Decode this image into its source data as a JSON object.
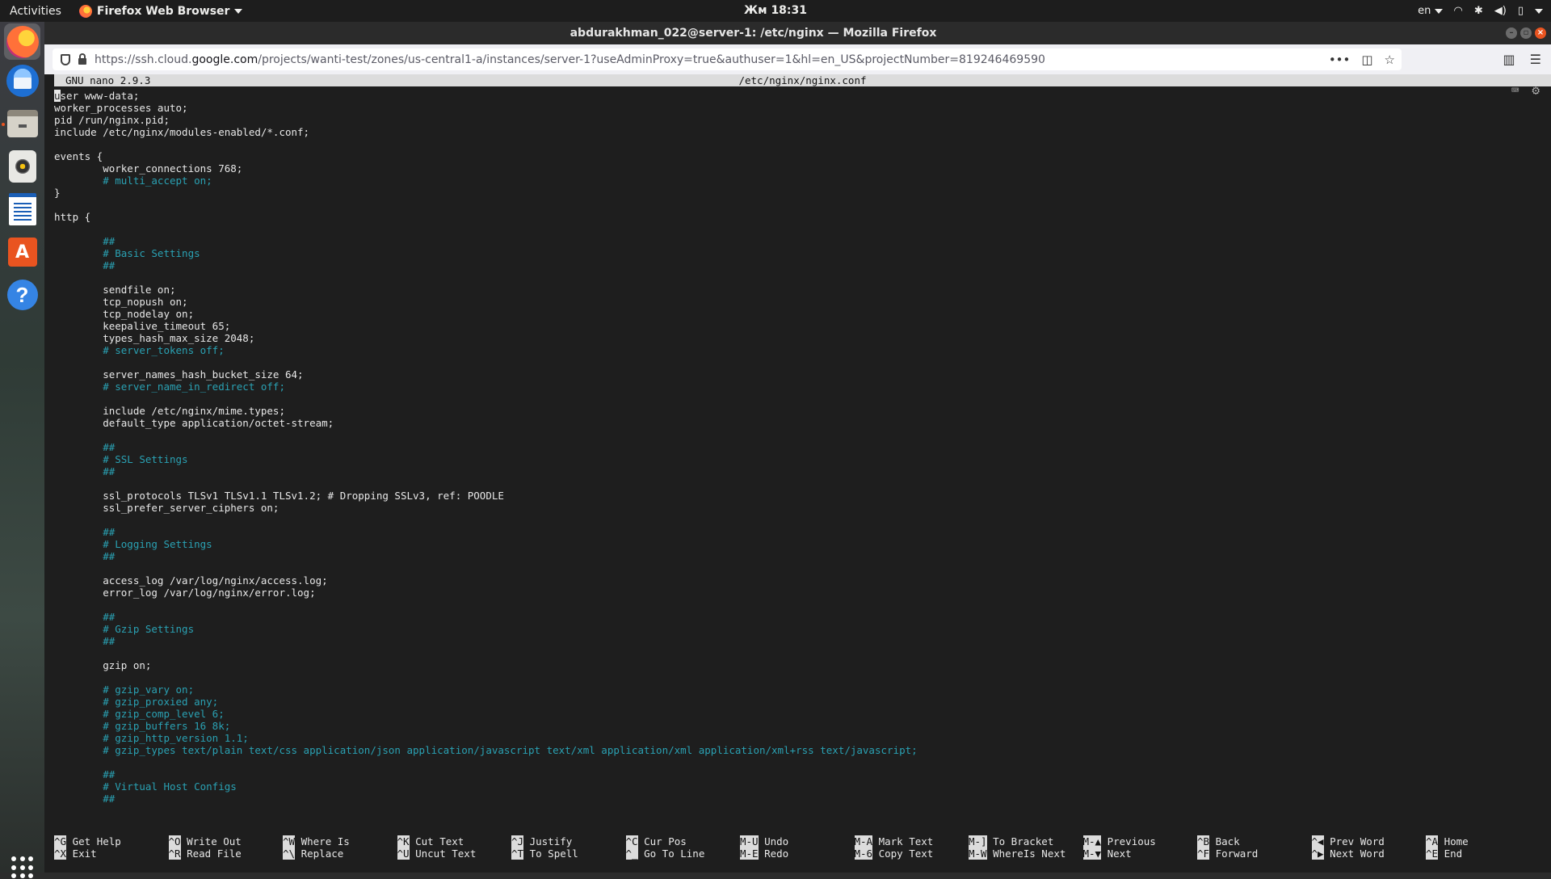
{
  "topbar": {
    "activities": "Activities",
    "app_name": "Firefox Web Browser",
    "clock": "Жм 18:31",
    "lang": "en"
  },
  "window": {
    "title": "abdurakhman_022@server-1: /etc/nginx — Mozilla Firefox"
  },
  "urlbar": {
    "url_prefix": "https://ssh.cloud.",
    "url_domain": "google.com",
    "url_rest": "/projects/wanti-test/zones/us-central1-a/instances/server-1?useAdminProxy=true&authuser=1&hl=en_US&projectNumber=819246469590"
  },
  "nano": {
    "version": "GNU nano 2.9.3",
    "filename": "/etc/nginx/nginx.conf",
    "lines": [
      {
        "t": "user www-data;",
        "c": false
      },
      {
        "t": "worker_processes auto;",
        "c": false
      },
      {
        "t": "pid /run/nginx.pid;",
        "c": false
      },
      {
        "t": "include /etc/nginx/modules-enabled/*.conf;",
        "c": false
      },
      {
        "t": "",
        "c": false
      },
      {
        "t": "events {",
        "c": false
      },
      {
        "t": "        worker_connections 768;",
        "c": false
      },
      {
        "t": "        # multi_accept on;",
        "c": true
      },
      {
        "t": "}",
        "c": false
      },
      {
        "t": "",
        "c": false
      },
      {
        "t": "http {",
        "c": false
      },
      {
        "t": "",
        "c": false
      },
      {
        "t": "        ##",
        "c": true
      },
      {
        "t": "        # Basic Settings",
        "c": true
      },
      {
        "t": "        ##",
        "c": true
      },
      {
        "t": "",
        "c": false
      },
      {
        "t": "        sendfile on;",
        "c": false
      },
      {
        "t": "        tcp_nopush on;",
        "c": false
      },
      {
        "t": "        tcp_nodelay on;",
        "c": false
      },
      {
        "t": "        keepalive_timeout 65;",
        "c": false
      },
      {
        "t": "        types_hash_max_size 2048;",
        "c": false
      },
      {
        "t": "        # server_tokens off;",
        "c": true
      },
      {
        "t": "",
        "c": false
      },
      {
        "t": "        server_names_hash_bucket_size 64;",
        "c": false
      },
      {
        "t": "        # server_name_in_redirect off;",
        "c": true
      },
      {
        "t": "",
        "c": false
      },
      {
        "t": "        include /etc/nginx/mime.types;",
        "c": false
      },
      {
        "t": "        default_type application/octet-stream;",
        "c": false
      },
      {
        "t": "",
        "c": false
      },
      {
        "t": "        ##",
        "c": true
      },
      {
        "t": "        # SSL Settings",
        "c": true
      },
      {
        "t": "        ##",
        "c": true
      },
      {
        "t": "",
        "c": false
      },
      {
        "t": "        ssl_protocols TLSv1 TLSv1.1 TLSv1.2; # Dropping SSLv3, ref: POODLE",
        "c": false
      },
      {
        "t": "        ssl_prefer_server_ciphers on;",
        "c": false
      },
      {
        "t": "",
        "c": false
      },
      {
        "t": "        ##",
        "c": true
      },
      {
        "t": "        # Logging Settings",
        "c": true
      },
      {
        "t": "        ##",
        "c": true
      },
      {
        "t": "",
        "c": false
      },
      {
        "t": "        access_log /var/log/nginx/access.log;",
        "c": false
      },
      {
        "t": "        error_log /var/log/nginx/error.log;",
        "c": false
      },
      {
        "t": "",
        "c": false
      },
      {
        "t": "        ##",
        "c": true
      },
      {
        "t": "        # Gzip Settings",
        "c": true
      },
      {
        "t": "        ##",
        "c": true
      },
      {
        "t": "",
        "c": false
      },
      {
        "t": "        gzip on;",
        "c": false
      },
      {
        "t": "",
        "c": false
      },
      {
        "t": "        # gzip_vary on;",
        "c": true
      },
      {
        "t": "        # gzip_proxied any;",
        "c": true
      },
      {
        "t": "        # gzip_comp_level 6;",
        "c": true
      },
      {
        "t": "        # gzip_buffers 16 8k;",
        "c": true
      },
      {
        "t": "        # gzip_http_version 1.1;",
        "c": true
      },
      {
        "t": "        # gzip_types text/plain text/css application/json application/javascript text/xml application/xml application/xml+rss text/javascript;",
        "c": true
      },
      {
        "t": "",
        "c": false
      },
      {
        "t": "        ##",
        "c": true
      },
      {
        "t": "        # Virtual Host Configs",
        "c": true
      },
      {
        "t": "        ##",
        "c": true
      }
    ],
    "shortcuts": [
      [
        {
          "k": "^G",
          "l": "Get Help"
        },
        {
          "k": "^X",
          "l": "Exit"
        }
      ],
      [
        {
          "k": "^O",
          "l": "Write Out"
        },
        {
          "k": "^R",
          "l": "Read File"
        }
      ],
      [
        {
          "k": "^W",
          "l": "Where Is"
        },
        {
          "k": "^\\",
          "l": "Replace"
        }
      ],
      [
        {
          "k": "^K",
          "l": "Cut Text"
        },
        {
          "k": "^U",
          "l": "Uncut Text"
        }
      ],
      [
        {
          "k": "^J",
          "l": "Justify"
        },
        {
          "k": "^T",
          "l": "To Spell"
        }
      ],
      [
        {
          "k": "^C",
          "l": "Cur Pos"
        },
        {
          "k": "^_",
          "l": "Go To Line"
        }
      ],
      [
        {
          "k": "M-U",
          "l": "Undo"
        },
        {
          "k": "M-E",
          "l": "Redo"
        }
      ],
      [
        {
          "k": "M-A",
          "l": "Mark Text"
        },
        {
          "k": "M-6",
          "l": "Copy Text"
        }
      ],
      [
        {
          "k": "M-]",
          "l": "To Bracket"
        },
        {
          "k": "M-W",
          "l": "WhereIs Next"
        }
      ],
      [
        {
          "k": "M-▲",
          "l": "Previous"
        },
        {
          "k": "M-▼",
          "l": "Next"
        }
      ],
      [
        {
          "k": "^B",
          "l": "Back"
        },
        {
          "k": "^F",
          "l": "Forward"
        }
      ],
      [
        {
          "k": "^◀",
          "l": "Prev Word"
        },
        {
          "k": "^▶",
          "l": "Next Word"
        }
      ],
      [
        {
          "k": "^A",
          "l": "Home"
        },
        {
          "k": "^E",
          "l": "End"
        }
      ]
    ]
  }
}
